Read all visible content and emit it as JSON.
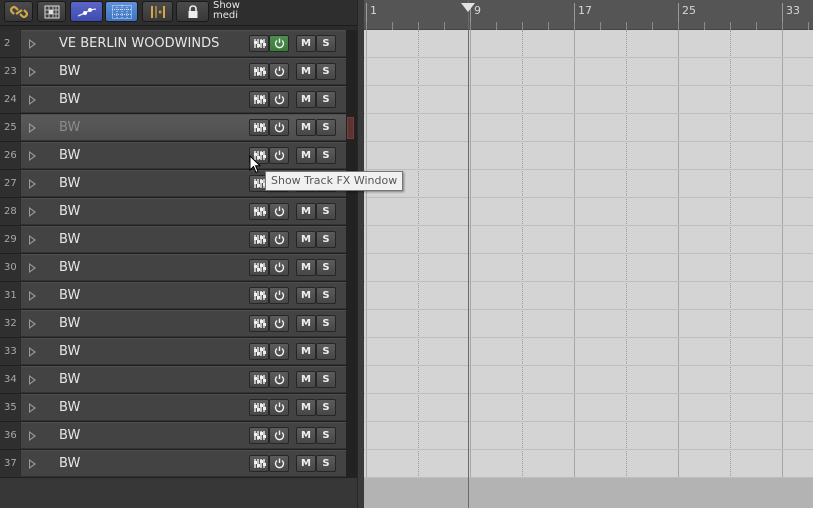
{
  "toolbar": {
    "buttons": [
      {
        "name": "link-icon",
        "color": "#d4a84a"
      },
      {
        "name": "grid-snap-icon"
      },
      {
        "name": "envelope-icon",
        "color": "#4a5bd6"
      },
      {
        "name": "grid-icon",
        "color": "#5a8ad6"
      },
      {
        "name": "ripple-edit-icon",
        "color": "#d4a84a"
      },
      {
        "name": "lock-icon"
      }
    ],
    "show_media_line1": "Show",
    "show_media_line2": "medi"
  },
  "tracks": [
    {
      "num": "2",
      "name": "VE BERLIN WOODWINDS",
      "power_on": true,
      "selected": false
    },
    {
      "num": "23",
      "name": "BW",
      "power_on": false,
      "selected": false
    },
    {
      "num": "24",
      "name": "BW",
      "power_on": false,
      "selected": false
    },
    {
      "num": "25",
      "name": "BW",
      "power_on": false,
      "selected": true
    },
    {
      "num": "26",
      "name": "BW",
      "power_on": false,
      "selected": false
    },
    {
      "num": "27",
      "name": "BW",
      "power_on": false,
      "selected": false
    },
    {
      "num": "28",
      "name": "BW",
      "power_on": false,
      "selected": false
    },
    {
      "num": "29",
      "name": "BW",
      "power_on": false,
      "selected": false
    },
    {
      "num": "30",
      "name": "BW",
      "power_on": false,
      "selected": false
    },
    {
      "num": "31",
      "name": "BW",
      "power_on": false,
      "selected": false
    },
    {
      "num": "32",
      "name": "BW",
      "power_on": false,
      "selected": false
    },
    {
      "num": "33",
      "name": "BW",
      "power_on": false,
      "selected": false
    },
    {
      "num": "34",
      "name": "BW",
      "power_on": false,
      "selected": false
    },
    {
      "num": "35",
      "name": "BW",
      "power_on": false,
      "selected": false
    },
    {
      "num": "36",
      "name": "BW",
      "power_on": false,
      "selected": false
    },
    {
      "num": "37",
      "name": "BW",
      "power_on": false,
      "selected": false
    }
  ],
  "track_buttons": {
    "mute_label": "M",
    "solo_label": "S",
    "fx_icon": "fx-chain-icon",
    "power_icon": "power-icon"
  },
  "ruler": {
    "bars": [
      "1",
      "9",
      "17",
      "25",
      "33"
    ]
  },
  "tooltip": {
    "text": "Show Track FX Window"
  }
}
